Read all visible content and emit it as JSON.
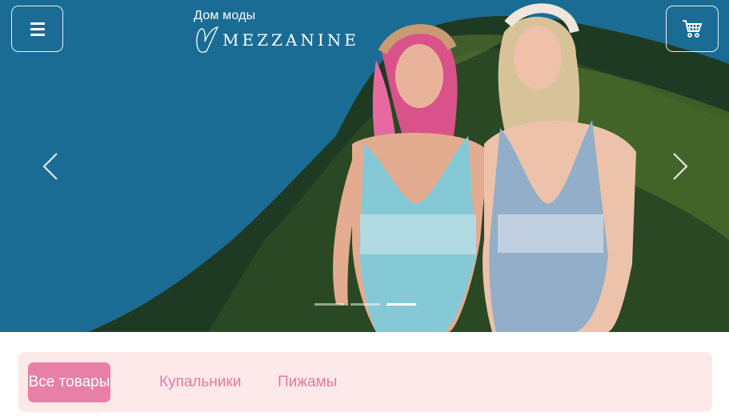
{
  "header": {
    "brand_subtitle": "Дом моды",
    "brand_name": "MEZZANINE"
  },
  "icons": {
    "menu": "hamburger-menu-icon",
    "cart": "shopping-cart-icon",
    "prev": "chevron-left-icon",
    "next": "chevron-right-icon"
  },
  "carousel": {
    "slide_count": 3,
    "active_index": 2
  },
  "filters": {
    "tabs": [
      {
        "label": "Все товары",
        "active": true
      },
      {
        "label": "Купальники",
        "active": false
      },
      {
        "label": "Пижамы",
        "active": false
      }
    ]
  },
  "colors": {
    "accent": "#e87fa5",
    "filter_bg": "#fde9ea",
    "tab_text": "#e87aa1"
  }
}
